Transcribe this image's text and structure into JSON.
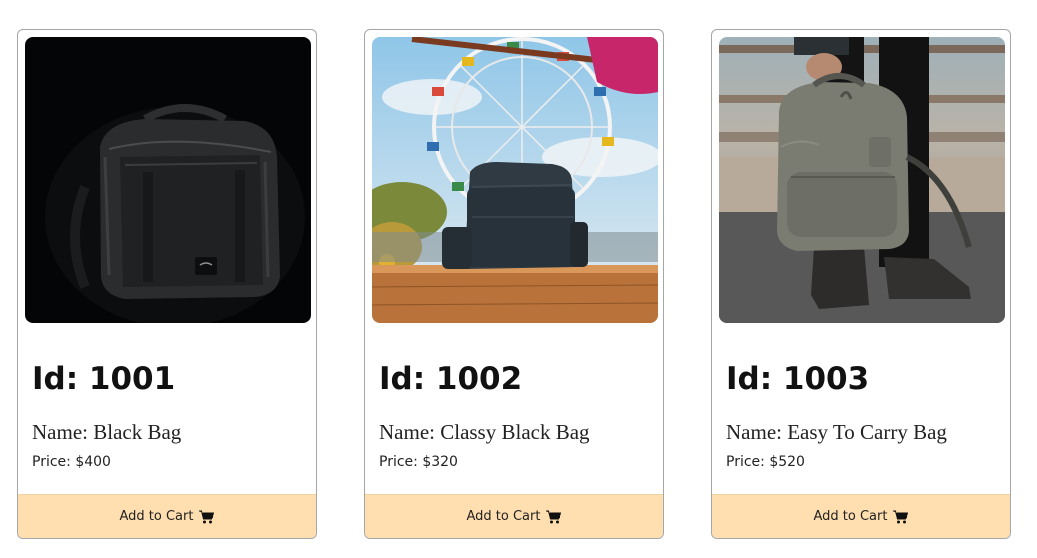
{
  "products": [
    {
      "id_label": "Id: 1001",
      "name_label": "Name: Black Bag",
      "price_label": "Price: $400",
      "image_icon": "black-backpack-photo"
    },
    {
      "id_label": "Id: 1002",
      "name_label": "Name: Classy Black Bag",
      "price_label": "Price: $320",
      "image_icon": "backpack-ferris-wheel-photo"
    },
    {
      "id_label": "Id: 1003",
      "name_label": "Name: Easy To Carry Bag",
      "price_label": "Price: $520",
      "image_icon": "grey-backpack-carried-photo"
    }
  ],
  "add_to_cart_label": "Add to Cart",
  "cart_icon": "shopping-cart-icon",
  "colors": {
    "button_bg": "#ffdeaf",
    "card_border": "#a6a6a6"
  }
}
